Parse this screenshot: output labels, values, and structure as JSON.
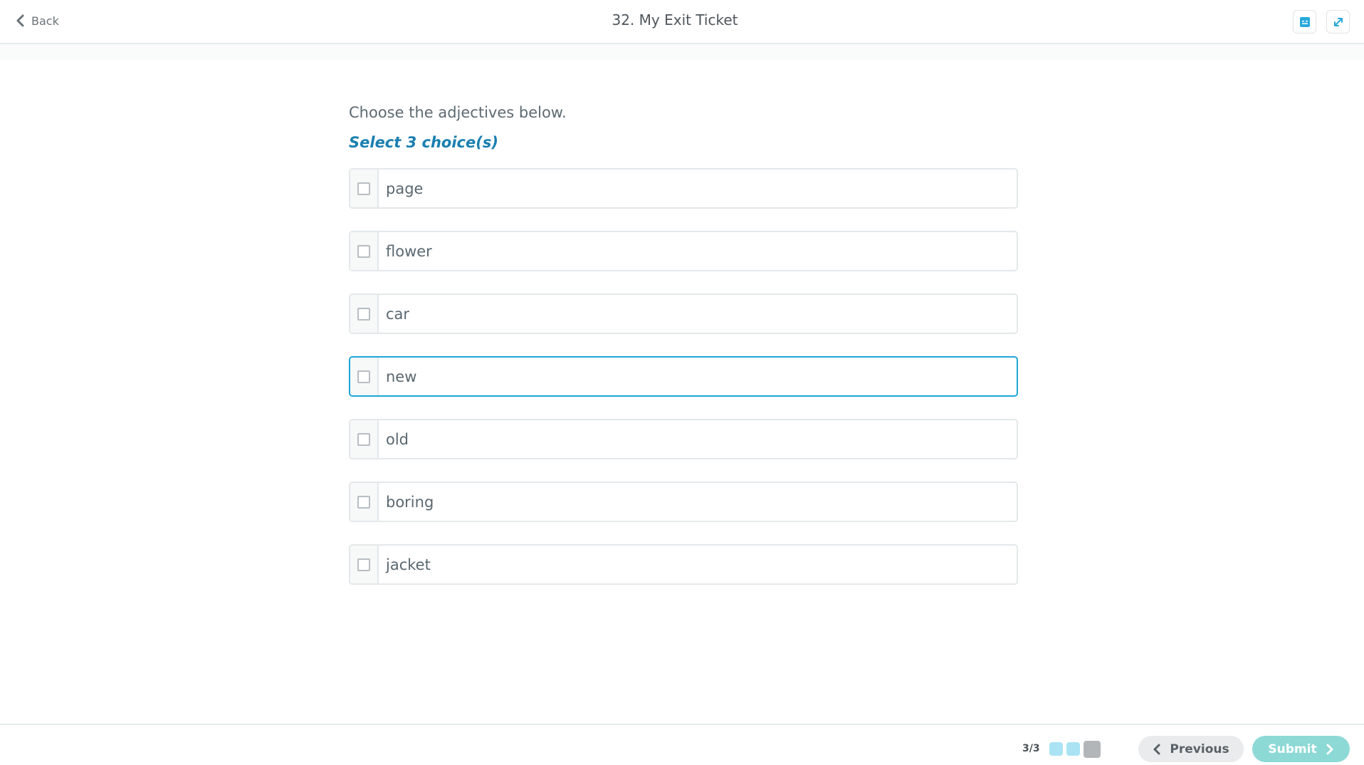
{
  "header": {
    "back_label": "Back",
    "title": "32. My Exit Ticket"
  },
  "question": {
    "prompt": "Choose the adjectives below.",
    "instruction": "Select 3 choice(s)",
    "choices": [
      {
        "label": "page",
        "checked": false
      },
      {
        "label": "flower",
        "checked": false
      },
      {
        "label": "car",
        "checked": false
      },
      {
        "label": "new",
        "checked": false,
        "focused": true
      },
      {
        "label": "old",
        "checked": false
      },
      {
        "label": "boring",
        "checked": false
      },
      {
        "label": "jacket",
        "checked": false
      }
    ]
  },
  "footer": {
    "progress": "3/3",
    "page_dots": [
      {
        "state": "answered",
        "color": "#a9e3f4"
      },
      {
        "state": "answered",
        "color": "#a9e3f4"
      },
      {
        "state": "current",
        "color": "#b3b6b8"
      }
    ],
    "previous_label": "Previous",
    "submit_label": "Submit"
  },
  "colors": {
    "accent": "#1ca7d8",
    "instruction": "#1a7fb0",
    "submit_bg": "#8dd9d6"
  },
  "icons": {
    "back": "chevron-left-icon",
    "tool": "calculator-icon",
    "fullscreen": "expand-icon"
  }
}
